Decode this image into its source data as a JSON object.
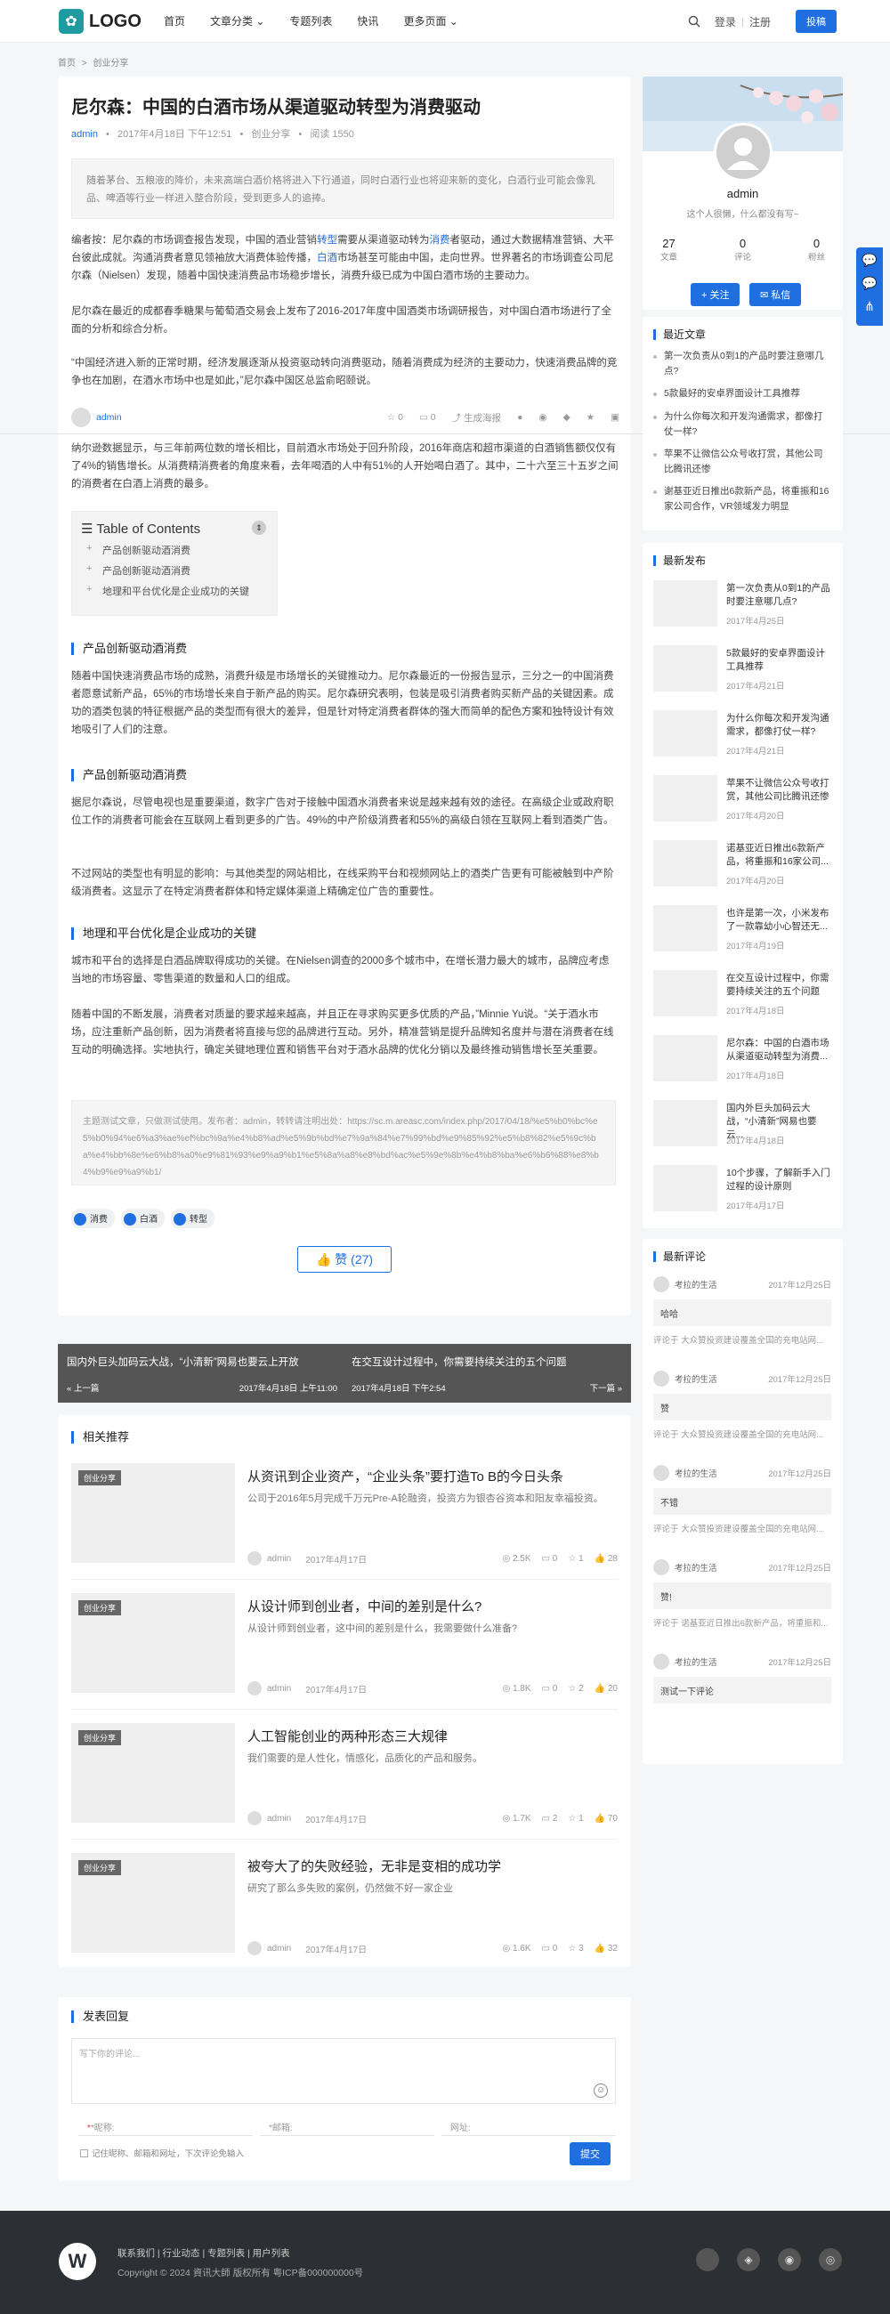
{
  "header": {
    "logo_text": "LOGO",
    "nav": [
      "首页",
      "文章分类 ⌄",
      "专题列表",
      "快讯",
      "更多页面 ⌄"
    ],
    "login": "登录",
    "separator": "|",
    "register": "注册",
    "post_button": "投稿"
  },
  "breadcrumb": {
    "home": "首页",
    "sep": ">",
    "current": "创业分享"
  },
  "article": {
    "title": "尼尔森：中国的白酒市场从渠道驱动转型为消费驱动",
    "author": "admin",
    "date": "2017年4月18日 下午12:51",
    "category": "创业分享",
    "views": "阅读 1550",
    "summary": "随着茅台、五粮液的降价，未来高端白酒价格将进入下行通道，同时白酒行业也将迎来新的变化，白酒行业可能会像乳品、啤酒等行业一样进入整合阶段，受到更多人的追捧。",
    "p1_a": "编者按：尼尔森的市场调查报告发现，中国的酒业营销",
    "p1_link1": "转型",
    "p1_b": "需要从渠道驱动转为",
    "p1_link2": "消费",
    "p1_c": "者驱动，通过大数据精准营销、大平台彼此成就。沟通消费者意见领袖放大消费体验传播，",
    "p1_link3": "白酒",
    "p1_d": "市场甚至可能由中国，走向世界。世界著名的市场调查公司尼尔森（Nielsen）发现，随着中国快速消费品市场稳步增长，消费升级已成为中国白酒市场的主要动力。",
    "p2": "尼尔森在最近的成都春季糖果与葡萄酒交易会上发布了2016-2017年度中国酒类市场调研报告，对中国白酒市场进行了全面的分析和综合分析。",
    "p3": "“中国经济进入新的正常时期，经济发展逐渐从投资驱动转向消费驱动，随着消费成为经济的主要动力，快速消费品牌的竞争也在加剧，在酒水市场中也是如此，”尼尔森中国区总监俞昭颐说。",
    "p4": "纳尔逊数据显示，与三年前两位数的增长相比，目前酒水市场处于回升阶段，2016年商店和超市渠道的白酒销售额仅仅有了4%的销售增长。从消费精消费者的角度来看，去年喝酒的人中有51%的人开始喝白酒了。其中，二十六至三十五岁之间的消费者在白酒上消费的最多。",
    "toc": {
      "title": "Table of Contents",
      "items": [
        "产品创新驱动酒消费",
        "产品创新驱动酒消费",
        "地理和平台优化是企业成功的关键"
      ]
    },
    "h2_1": "产品创新驱动酒消费",
    "p5": "随着中国快速消费品市场的成熟，消费升级是市场增长的关键推动力。尼尔森最近的一份报告显示，三分之一的中国消费者愿意试新产品，65%的市场增长来自于新产品的购买。尼尔森研究表明，包装是吸引消费者购买新产品的关键因素。成功的酒类包装的特征根据产品的类型而有很大的差异，但是针对特定消费者群体的强大而简单的配色方案和独特设计有效地吸引了人们的注意。",
    "h2_2": "产品创新驱动酒消费",
    "p6": "据尼尔森说，尽管电视也是重要渠道，数字广告对于接触中国酒水消费者来说是越来越有效的途径。在高级企业或政府职位工作的消费者可能会在互联网上看到更多的广告。49%的中产阶级消费者和55%的高级白领在互联网上看到酒类广告。",
    "p7": "不过网站的类型也有明显的影响：与其他类型的网站相比，在线采购平台和视频网站上的酒类广告更有可能被触到中产阶级消费者。这显示了在特定消费者群体和特定媒体渠道上精确定位广告的重要性。",
    "h2_3": "地理和平台优化是企业成功的关键",
    "p8": "城市和平台的选择是白酒品牌取得成功的关键。在Nielsen调查的2000多个城市中，在增长潜力最大的城市，品牌应考虑当地的市场容量、零售渠道的数量和人口的组成。",
    "p9": "随着中国的不断发展，消费者对质量的要求越来越高，并且正在寻求购买更多优质的产品，”Minnie Yu说。“关于酒水市场，应注重新产品创新，因为消费者将直接与您的品牌进行互动。另外，精准营销是提升品牌知名度并与潜在消费者在线互动的明确选择。实地执行，确定关键地理位置和销售平台对于酒水品牌的优化分销以及最终推动销售增长至关重要。",
    "source": "主题测试文章，只做测试使用。发布者：admin，转转请注明出处：https://sc.m.areasc.com/index.php/2017/04/18/%e5%b0%bc%e5%b0%94%e6%a3%ae%ef%bc%9a%e4%b8%ad%e5%9b%bd%e7%9a%84%e7%99%bd%e9%85%92%e5%b8%82%e5%9c%ba%e4%bb%8e%e6%b8%a0%e9%81%93%e9%a9%b1%e5%8a%a8%e8%bd%ac%e5%9e%8b%e4%b8%ba%e6%b6%88%e8%b4%b9%e9%a9%b1/",
    "tags": [
      "消费",
      "白酒",
      "转型"
    ],
    "like_label": "赞 (27)",
    "share_bar": {
      "stars": "0",
      "comments": "0",
      "poster": "生成海报"
    }
  },
  "prev_next": {
    "prev_title": "国内外巨头加码云大战，“小清新”网易也要云上开放",
    "prev_label": "« 上一篇",
    "prev_date": "2017年4月18日 上午11:00",
    "next_title": "在交互设计过程中，你需要持续关注的五个问题",
    "next_date": "2017年4月18日 下午2:54",
    "next_label": "下一篇 »"
  },
  "related": {
    "title": "相关推荐",
    "items": [
      {
        "badge": "创业分享",
        "title": "从资讯到企业资产，“企业头条”要打造To B的今日头条",
        "desc": "公司于2016年5月完成千万元Pre-A轮融资，投资方为银杏谷资本和阳友幸福投资。",
        "author": "admin",
        "date": "2017年4月17日",
        "views": "2.5K",
        "comments": "0",
        "stars": "1",
        "likes": "28"
      },
      {
        "badge": "创业分享",
        "title": "从设计师到创业者，中间的差别是什么?",
        "desc": "从设计师到创业者，这中间的差别是什么，我需要做什么准备?",
        "author": "admin",
        "date": "2017年4月17日",
        "views": "1.8K",
        "comments": "0",
        "stars": "2",
        "likes": "20"
      },
      {
        "badge": "创业分享",
        "title": "人工智能创业的两种形态三大规律",
        "desc": "我们需要的是人性化，情感化，品质化的产品和服务。",
        "author": "admin",
        "date": "2017年4月17日",
        "views": "1.7K",
        "comments": "2",
        "stars": "1",
        "likes": "70"
      },
      {
        "badge": "创业分享",
        "title": "被夸大了的失败经验，无非是变相的成功学",
        "desc": "研究了那么多失败的案例，仍然做不好一家企业",
        "author": "admin",
        "date": "2017年4月17日",
        "views": "1.6K",
        "comments": "0",
        "stars": "3",
        "likes": "32"
      }
    ]
  },
  "comment_form": {
    "title": "发表回复",
    "placeholder": "写下你的评论...",
    "name": "*昵称:",
    "email": "*邮箱:",
    "url": "网址:",
    "remember": "记住昵称、邮箱和网址，下次评论免输入",
    "submit": "提交"
  },
  "profile": {
    "name": "admin",
    "bio": "这个人很懒，什么都没有写~",
    "stats": [
      {
        "value": "27",
        "label": "文章"
      },
      {
        "value": "0",
        "label": "评论"
      },
      {
        "value": "0",
        "label": "粉丝"
      }
    ],
    "follow": "+ 关注",
    "message": "私信"
  },
  "recent_posts": {
    "title": "最近文章",
    "items": [
      "第一次负责从0到1的产品时要注意哪几点?",
      "5款最好的安卓界面设计工具推荐",
      "为什么你每次和开发沟通需求，都像打仗一样?",
      "苹果不让微信公众号收打赏，其他公司比腾讯还惨",
      "谢基亚近日推出6款新产品，将重振和16家公司合作，VR领域发力明显"
    ]
  },
  "latest": {
    "title": "最新发布",
    "items": [
      {
        "title": "第一次负责从0到1的产品时要注意哪几点?",
        "date": "2017年4月25日"
      },
      {
        "title": "5款最好的安卓界面设计工具推荐",
        "date": "2017年4月21日"
      },
      {
        "title": "为什么你每次和开发沟通需求，都像打仗一样?",
        "date": "2017年4月21日"
      },
      {
        "title": "苹果不让微信公众号收打赏，其他公司比腾讯还惨",
        "date": "2017年4月20日"
      },
      {
        "title": "诺基亚近日推出6款新产品，将重振和16家公司...",
        "date": "2017年4月20日"
      },
      {
        "title": "也许是第一次，小米发布了一款靠幼小心智还无...",
        "date": "2017年4月19日"
      },
      {
        "title": "在交互设计过程中，你需要持续关注的五个问题",
        "date": "2017年4月18日"
      },
      {
        "title": "尼尔森：中国的白酒市场从渠道驱动转型为消费...",
        "date": "2017年4月18日"
      },
      {
        "title": "国内外巨头加码云大战，“小清新”网易也要云...",
        "date": "2017年4月18日"
      },
      {
        "title": "10个步骤，了解新手入门过程的设计原则",
        "date": "2017年4月17日"
      }
    ]
  },
  "latest_comments": {
    "title": "最新评论",
    "items": [
      {
        "user": "考拉的生活",
        "date": "2017年12月25日",
        "text": "哈哈",
        "sub": "评论于 大众赞投资建设覆盖全国的充电站网..."
      },
      {
        "user": "考拉的生活",
        "date": "2017年12月25日",
        "text": "赞",
        "sub": "评论于 大众赞投资建设覆盖全国的充电站网..."
      },
      {
        "user": "考拉的生活",
        "date": "2017年12月25日",
        "text": "不错",
        "sub": "评论于 大众赞投资建设覆盖全国的充电站网..."
      },
      {
        "user": "考拉的生活",
        "date": "2017年12月25日",
        "text": "赞!",
        "sub": "评论于 诺基亚近日推出6款新产品，将重振和..."
      },
      {
        "user": "考拉的生活",
        "date": "2017年12月25日",
        "text": "测试一下评论",
        "sub": ""
      }
    ]
  },
  "footer": {
    "links": "联系我们 | 行业动态 | 专题列表 | 用户列表",
    "copyright": "Copyright © 2024 資讯大師 版权所有 粤ICP备000000000号",
    "logo_letter": "W"
  },
  "colors": {
    "accent": "#1f6fe0",
    "footer_bg": "#2c2f33"
  }
}
